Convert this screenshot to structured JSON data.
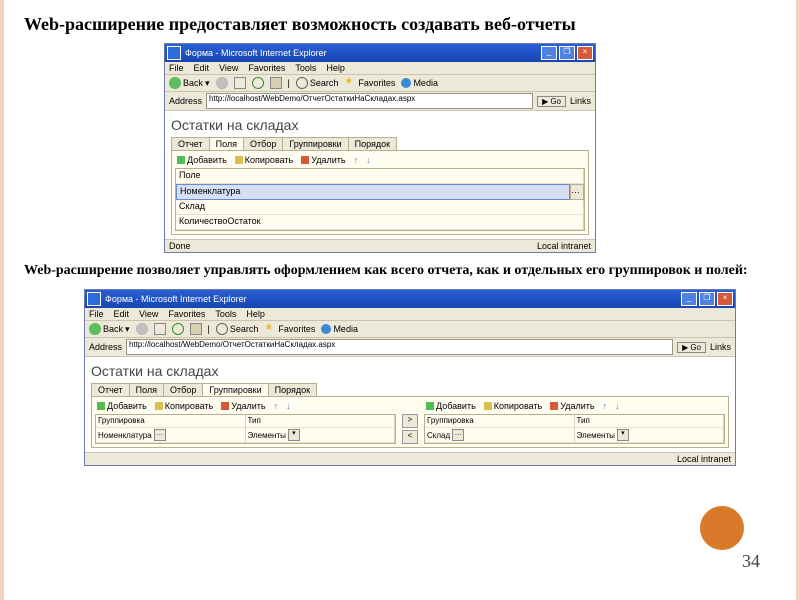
{
  "slide": {
    "heading": "Web-расширение предоставляет возможность создавать веб-отчеты",
    "desc": "Web-расширение позволяет управлять оформлением как всего отчета, как и отдельных его группировок и полей:",
    "page_number": "34"
  },
  "ie_common": {
    "window_title": "Форма - Microsoft Internet Explorer",
    "menus": [
      "File",
      "Edit",
      "View",
      "Favorites",
      "Tools",
      "Help"
    ],
    "back": "Back",
    "search": "Search",
    "favorites": "Favorites",
    "media": "Media",
    "address_label": "Address",
    "url": "http://localhost/WebDemo/ОтчетОстаткиНаСкладах.aspx",
    "go": "Go",
    "links": "Links",
    "status_done": "Done",
    "status_zone": "Local intranet"
  },
  "report": {
    "title": "Остатки на складах",
    "tabs": [
      "Отчет",
      "Поля",
      "Отбор",
      "Группировки",
      "Порядок"
    ],
    "actions": {
      "add": "Добавить",
      "copy": "Копировать",
      "del": "Удалить"
    },
    "screen1": {
      "active_tab": 1,
      "field_header": "Поле",
      "rows": [
        "Номенклатура",
        "Склад",
        "КоличествоОстаток"
      ]
    },
    "screen2": {
      "active_tab": 3,
      "col_group": "Группировка",
      "col_type": "Тип",
      "left": {
        "group": "Номенклатура",
        "type": "Элементы"
      },
      "right": {
        "group": "Склад",
        "type": "Элементы"
      }
    }
  }
}
